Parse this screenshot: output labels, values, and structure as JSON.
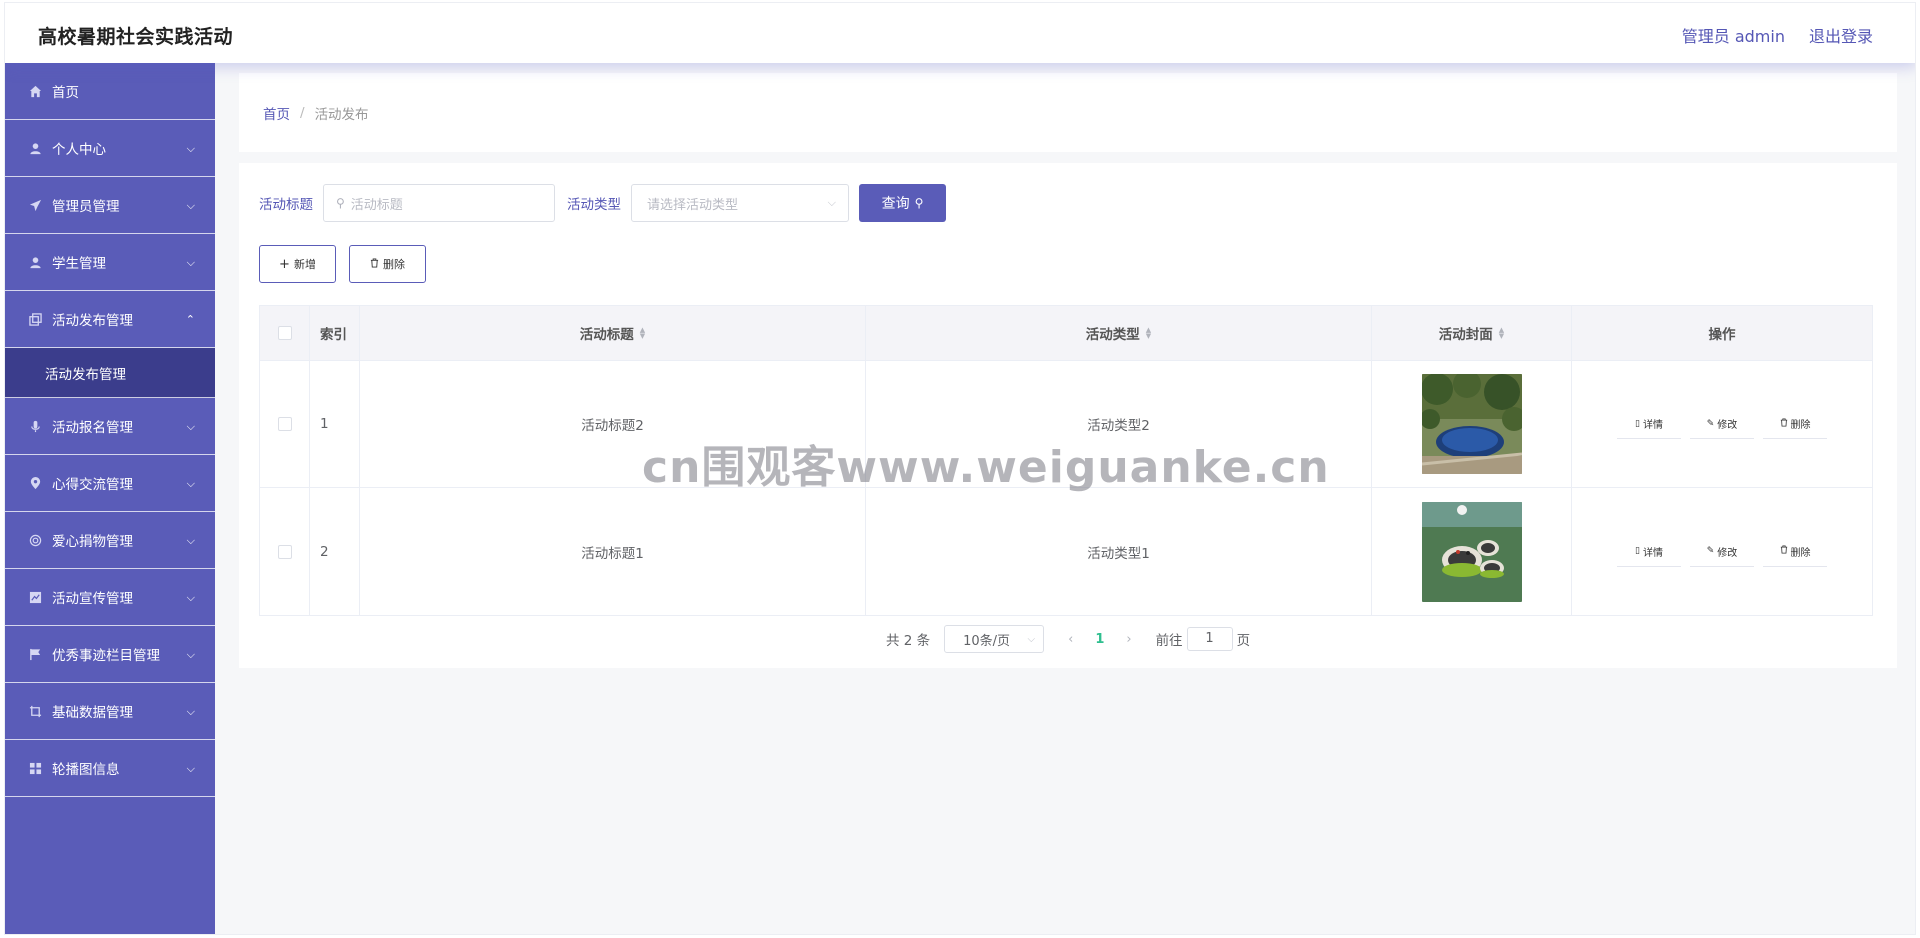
{
  "header": {
    "title": "高校暑期社会实践活动",
    "user_label": "管理员 admin",
    "logout_label": "退出登录"
  },
  "sidebar": {
    "items": [
      {
        "label": "首页",
        "icon": "home-icon",
        "chevron": ""
      },
      {
        "label": "个人中心",
        "icon": "user-icon",
        "chevron": "⌵"
      },
      {
        "label": "管理员管理",
        "icon": "send-icon",
        "chevron": "⌵"
      },
      {
        "label": "学生管理",
        "icon": "user-icon",
        "chevron": "⌵"
      },
      {
        "label": "活动发布管理",
        "icon": "copy-icon",
        "chevron": "⌃"
      },
      {
        "label": "活动报名管理",
        "icon": "mic-icon",
        "chevron": "⌵"
      },
      {
        "label": "心得交流管理",
        "icon": "location-icon",
        "chevron": "⌵"
      },
      {
        "label": "爱心捐物管理",
        "icon": "cycle-icon",
        "chevron": "⌵"
      },
      {
        "label": "活动宣传管理",
        "icon": "chart-icon",
        "chevron": "⌵"
      },
      {
        "label": "优秀事迹栏目管理",
        "icon": "flag-icon",
        "chevron": "⌵"
      },
      {
        "label": "基础数据管理",
        "icon": "crop-icon",
        "chevron": "⌵"
      },
      {
        "label": "轮播图信息",
        "icon": "grid-icon",
        "chevron": "⌵"
      }
    ],
    "active_sub": "活动发布管理"
  },
  "breadcrumb": {
    "home": "首页",
    "sep": "/",
    "current": "活动发布"
  },
  "search": {
    "title_label": "活动标题",
    "title_placeholder": "活动标题",
    "type_label": "活动类型",
    "type_placeholder": "请选择活动类型",
    "query_label": "查询"
  },
  "actions": {
    "add_label": "新增",
    "delete_label": "删除"
  },
  "table": {
    "headers": {
      "index": "索引",
      "title": "活动标题",
      "type": "活动类型",
      "cover": "活动封面",
      "ops": "操作"
    },
    "rows": [
      {
        "index": "1",
        "title": "活动标题2",
        "type": "活动类型2",
        "cover": "pool-photo"
      },
      {
        "index": "2",
        "title": "活动标题1",
        "type": "活动类型1",
        "cover": "trampoline-photo"
      }
    ],
    "op_labels": {
      "detail": "详情",
      "edit": "修改",
      "delete": "删除"
    }
  },
  "pagination": {
    "total": "共 2 条",
    "page_size": "10条/页",
    "current": "1",
    "goto_label": "前往",
    "goto_value": "1",
    "page_suffix": "页"
  },
  "watermark": "cn围观客www.weiguanke.cn",
  "colors": {
    "primary": "#5a5cb8",
    "sidebar_active": "#3b3d8c",
    "page_active": "#2fbf8f"
  }
}
